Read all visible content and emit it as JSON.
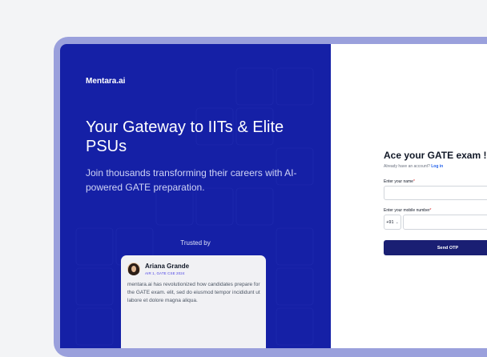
{
  "colors": {
    "panel_blue": "#1520a6",
    "button_navy": "#1a1f73",
    "link_blue": "#2563eb",
    "required_red": "#dc2626"
  },
  "brand": {
    "name": "Mentara.ai"
  },
  "hero": {
    "headline": "Your Gateway to IITs & Elite PSUs",
    "subhead": "Join thousands transforming their careers with AI-powered GATE preparation."
  },
  "social_proof": {
    "heading": "Trusted by",
    "testimonial": {
      "name": "Ariana Grande",
      "role": "AIR 1, GATE CSE 2024",
      "quote": "mentara.ai has revolutionized how candidates prepare for the GATE exam.  elit, sed do eiusmod tempor incididunt ut labore et dolore magna aliqua."
    }
  },
  "form": {
    "title": "Ace your GATE exam !",
    "account_prompt": "Already have an account?",
    "login_link": "Log in",
    "name_label": "Enter your name",
    "mobile_label": "Enter your mobile number",
    "required_mark": "*",
    "country_code": "+91",
    "submit_label": "Send OTP"
  }
}
